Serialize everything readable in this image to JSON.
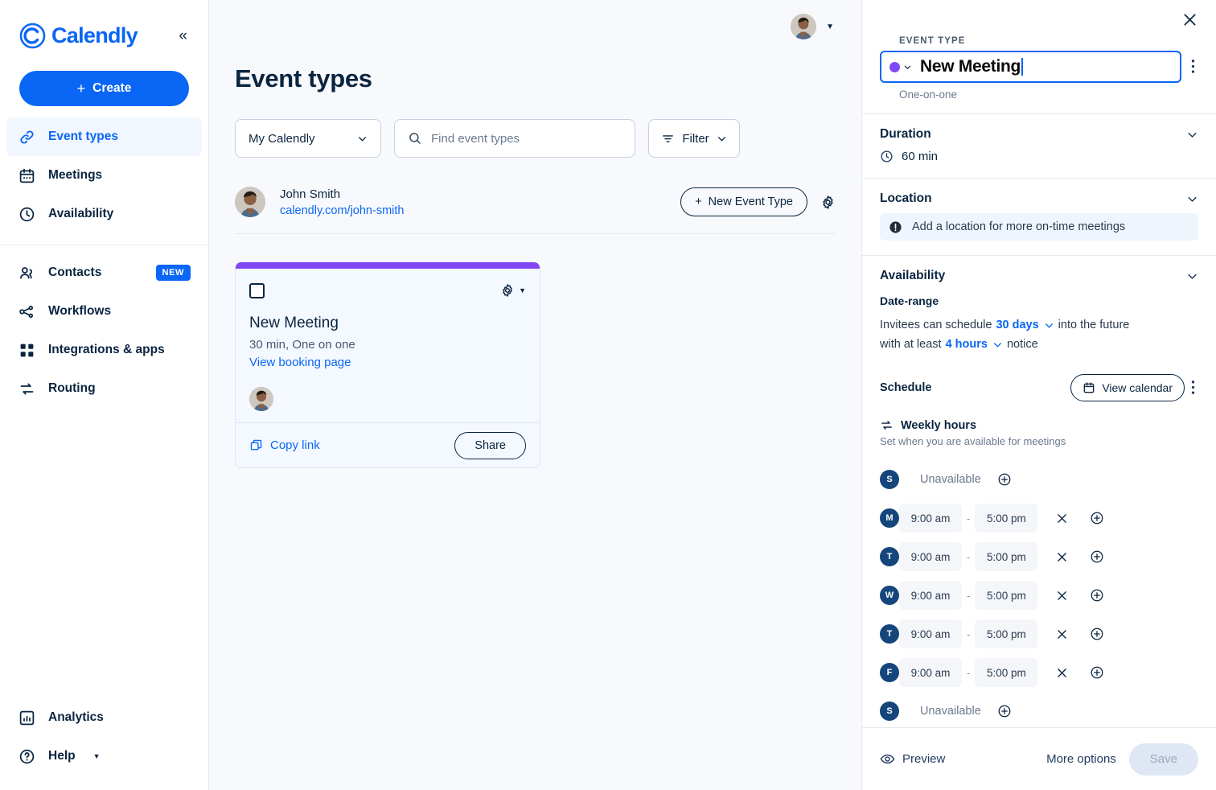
{
  "brand": {
    "name": "Calendly",
    "collapse_icon": "double-chevron-left-icon"
  },
  "sidebar": {
    "create_label": "Create",
    "items": [
      {
        "label": "Event types",
        "icon": "link-icon",
        "active": true
      },
      {
        "label": "Meetings",
        "icon": "calendar-icon",
        "active": false
      },
      {
        "label": "Availability",
        "icon": "clock-icon",
        "active": false
      }
    ],
    "items_lower": [
      {
        "label": "Contacts",
        "icon": "people-icon",
        "badge": "NEW"
      },
      {
        "label": "Workflows",
        "icon": "workflow-icon",
        "badge": ""
      },
      {
        "label": "Integrations & apps",
        "icon": "grid-icon",
        "badge": ""
      },
      {
        "label": "Routing",
        "icon": "routing-icon",
        "badge": ""
      }
    ],
    "bottom_items": [
      {
        "label": "Analytics",
        "icon": "bar-chart-icon",
        "caret": false
      },
      {
        "label": "Help",
        "icon": "question-circle-icon",
        "caret": true
      }
    ]
  },
  "main": {
    "page_title": "Event types",
    "org_select": {
      "value": "My Calendly",
      "icon": "chevron-down-icon"
    },
    "search": {
      "placeholder": "Find event types",
      "value": "",
      "icon": "search-icon"
    },
    "filter": {
      "label": "Filter",
      "icon": "filter-icon"
    },
    "user": {
      "name": "John Smith",
      "link": "calendly.com/john-smith",
      "new_event_type_label": "New Event Type",
      "settings_icon": "gear-icon"
    },
    "card": {
      "accent_color": "#8247f5",
      "title": "New Meeting",
      "subtitle": "30 min, One on one",
      "booking_link": "View booking page",
      "copy_link_label": "Copy link",
      "share_label": "Share"
    }
  },
  "panel": {
    "close_icon": "close-icon",
    "eyebrow": "EVENT TYPE",
    "title": "New Meeting",
    "title_dot_color": "#8247f5",
    "subtitle": "One-on-one",
    "duration": {
      "title": "Duration",
      "value": "60 min",
      "icon": "clock-icon"
    },
    "location": {
      "title": "Location",
      "banner": "Add a location for more on-time meetings",
      "banner_icon": "alert-icon"
    },
    "availability": {
      "title": "Availability",
      "date_range_label": "Date-range",
      "line1_pre": "Invitees can schedule",
      "line1_value": "30 days",
      "line1_post": "into the future",
      "line2_pre": "with at least",
      "line2_value": "4 hours",
      "line2_post": "notice",
      "schedule_label": "Schedule",
      "view_calendar_label": "View calendar",
      "weekly_hours_label": "Weekly hours",
      "weekly_hours_sub": "Set when you are available for meetings",
      "days": [
        {
          "letter": "S",
          "available": false,
          "unavailable_label": "Unavailable",
          "start": "",
          "end": ""
        },
        {
          "letter": "M",
          "available": true,
          "unavailable_label": "",
          "start": "9:00 am",
          "end": "5:00 pm"
        },
        {
          "letter": "T",
          "available": true,
          "unavailable_label": "",
          "start": "9:00 am",
          "end": "5:00 pm"
        },
        {
          "letter": "W",
          "available": true,
          "unavailable_label": "",
          "start": "9:00 am",
          "end": "5:00 pm"
        },
        {
          "letter": "T",
          "available": true,
          "unavailable_label": "",
          "start": "9:00 am",
          "end": "5:00 pm"
        },
        {
          "letter": "F",
          "available": true,
          "unavailable_label": "",
          "start": "9:00 am",
          "end": "5:00 pm"
        },
        {
          "letter": "S",
          "available": false,
          "unavailable_label": "Unavailable",
          "start": "",
          "end": ""
        }
      ],
      "time_separator": "-"
    },
    "footer": {
      "preview_label": "Preview",
      "more_options_label": "More options",
      "save_label": "Save"
    }
  },
  "colors": {
    "brand_blue": "#0a66f5",
    "accent_purple": "#8247f5",
    "navy": "#0a2540",
    "day_badge": "#14457b"
  }
}
